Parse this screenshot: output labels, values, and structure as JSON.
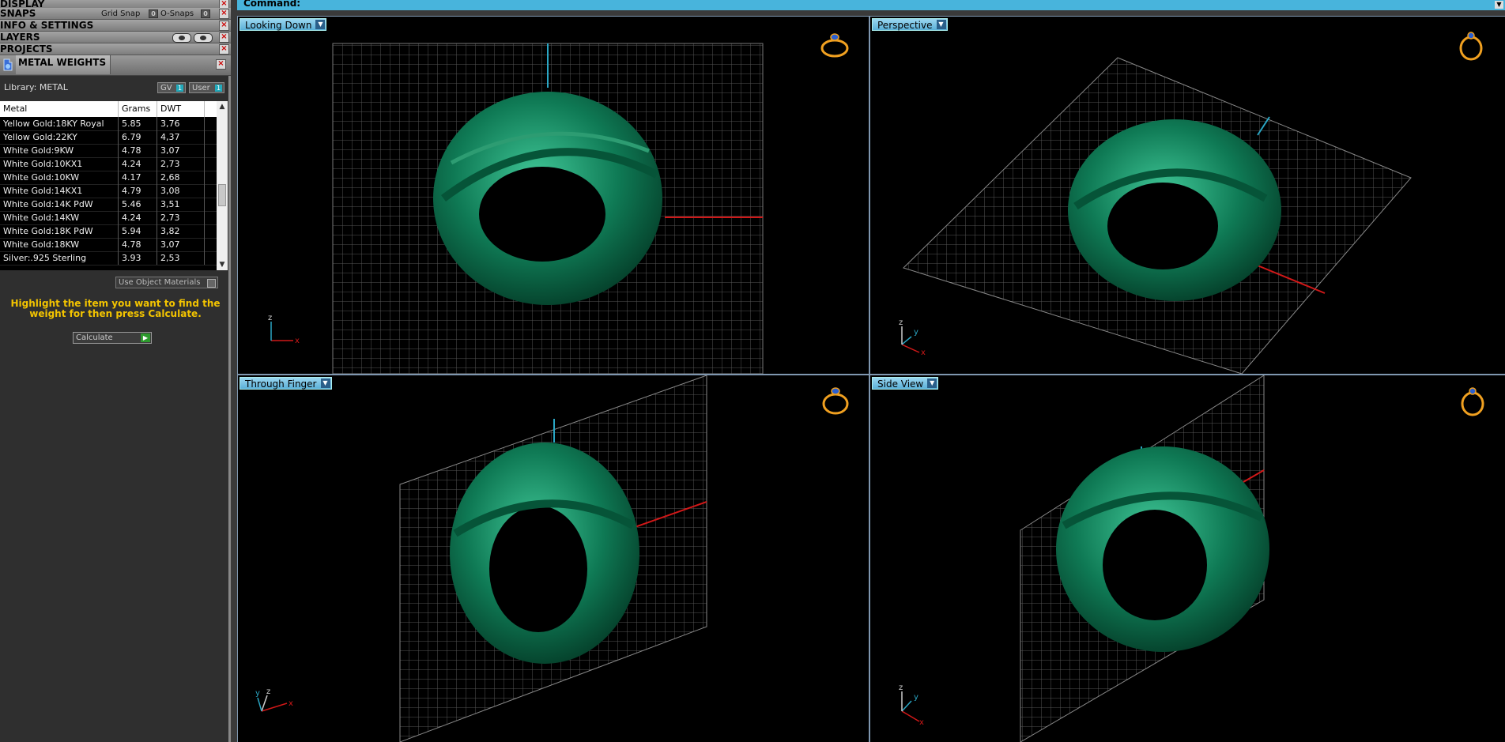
{
  "left_panel": {
    "sections": {
      "display": "DISPLAY",
      "snaps": "SNAPS",
      "info_settings": "INFO & SETTINGS",
      "layers": "LAYERS",
      "projects": "PROJECTS"
    },
    "snaps_options": {
      "grid_snap": "Grid Snap",
      "o_snaps": "O-Snaps"
    },
    "metal_weights": {
      "title": "METAL WEIGHTS",
      "library_label": "Library: METAL",
      "gv_button": "GV",
      "user_button": "User",
      "indicator": "1",
      "columns": [
        "Metal",
        "Grams",
        "DWT"
      ],
      "rows": [
        {
          "metal": "Yellow Gold:18KY Royal",
          "grams": "5.85",
          "dwt": "3,76"
        },
        {
          "metal": "Yellow Gold:22KY",
          "grams": "6.79",
          "dwt": "4,37"
        },
        {
          "metal": "White Gold:9KW",
          "grams": "4.78",
          "dwt": "3,07"
        },
        {
          "metal": "White Gold:10KX1",
          "grams": "4.24",
          "dwt": "2,73"
        },
        {
          "metal": "White Gold:10KW",
          "grams": "4.17",
          "dwt": "2,68"
        },
        {
          "metal": "White Gold:14KX1",
          "grams": "4.79",
          "dwt": "3,08"
        },
        {
          "metal": "White Gold:14K PdW",
          "grams": "5.46",
          "dwt": "3,51"
        },
        {
          "metal": "White Gold:14KW",
          "grams": "4.24",
          "dwt": "2,73"
        },
        {
          "metal": "White Gold:18K PdW",
          "grams": "5.94",
          "dwt": "3,82"
        },
        {
          "metal": "White Gold:18KW",
          "grams": "4.78",
          "dwt": "3,07"
        },
        {
          "metal": "Silver:.925 Sterling",
          "grams": "3.93",
          "dwt": "2,53"
        }
      ],
      "use_object_materials": "Use Object Materials",
      "hint": "Highlight the item you want to find the weight for then press Calculate.",
      "calculate_button": "Calculate"
    }
  },
  "command_bar": {
    "label": "Command:"
  },
  "viewports": [
    {
      "name": "Looking Down"
    },
    {
      "name": "Perspective"
    },
    {
      "name": "Through Finger"
    },
    {
      "name": "Side View"
    }
  ],
  "colors": {
    "accent": "#48b4dc",
    "ring_green": "#0f7a55",
    "highlight_text": "#f3c400",
    "x_axis": "#d01818",
    "y_axis": "#2aa6c4"
  }
}
